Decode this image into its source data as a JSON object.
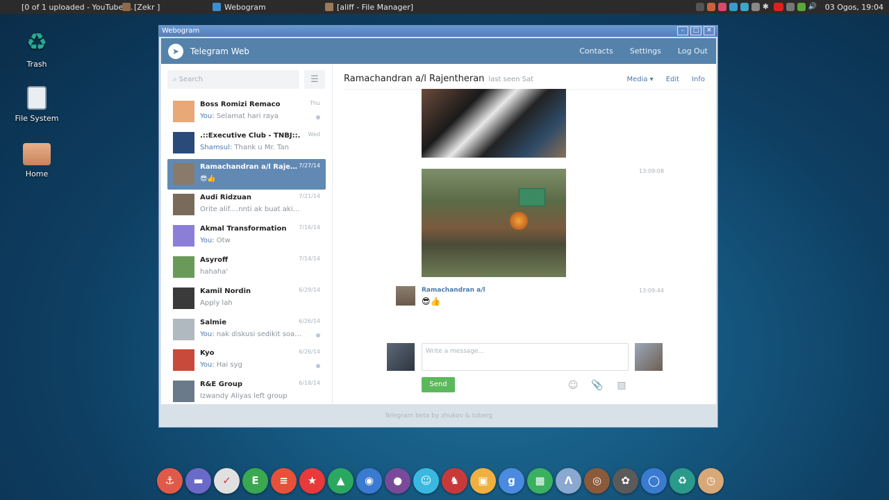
{
  "taskbar": {
    "tasks": [
      {
        "label": "[0 of 1 uploaded - YouTube ...",
        "color": "#7a5a4a"
      },
      {
        "label": "[Zekr  ]",
        "color": "#8a6a4a"
      },
      {
        "label": "Webogram",
        "color": "#3a8ed0"
      },
      {
        "label": "[aliff - File Manager]",
        "color": "#9a7a5a"
      }
    ],
    "clock": "03 Ogos, 19:04"
  },
  "desktop": {
    "icons": [
      {
        "label": "Trash"
      },
      {
        "label": "File System"
      },
      {
        "label": "Home"
      }
    ]
  },
  "window": {
    "title": "Webogram",
    "app_name": "Telegram Web",
    "nav": [
      "Contacts",
      "Settings",
      "Log Out"
    ],
    "footer": "Telegram beta by zhukov & toberg"
  },
  "sidebar": {
    "search_placeholder": "Search",
    "menu_icon": "☰",
    "chats": [
      {
        "name": "Boss Romizi Remaco",
        "date": "Thu",
        "you": "You:",
        "msg": " Selamat hari raya",
        "dot": true,
        "color": "#e8a878"
      },
      {
        "name": ".::Executive Club - TNBJ::.",
        "date": "Wed",
        "you": "Shamsul:",
        "msg": " Thank u Mr. Tan",
        "dot": false,
        "color": "#2a4a7a"
      },
      {
        "name": "Ramachandran a/l Rajentheran",
        "date": "7/27/14",
        "you": "",
        "msg": "😎👍",
        "dot": false,
        "color": "#8a7a6a"
      },
      {
        "name": "Audi Ridzuan",
        "date": "7/21/14",
        "you": "",
        "msg": "Orite alif....nnti ak buat akikah",
        "dot": false,
        "color": "#7a6a5a"
      },
      {
        "name": "Akmal Transformation",
        "date": "7/16/14",
        "you": "You:",
        "msg": " Otw",
        "dot": false,
        "color": "#8a7ed8"
      },
      {
        "name": "Asyroff",
        "date": "7/14/14",
        "you": "",
        "msg": "hahaha'",
        "dot": false,
        "color": "#6a9a5a"
      },
      {
        "name": "Kamil Nordin",
        "date": "6/29/14",
        "you": "",
        "msg": "Apply lah",
        "dot": false,
        "color": "#3a3a3a"
      },
      {
        "name": "Salmie",
        "date": "6/26/14",
        "you": "You:",
        "msg": " nak diskusi sedikit soal dokumen",
        "dot": true,
        "color": "#b0b8c0"
      },
      {
        "name": "Kyo",
        "date": "6/26/14",
        "you": "You:",
        "msg": " Hai syg",
        "dot": true,
        "color": "#c84a3a"
      },
      {
        "name": "R&E Group",
        "date": "6/18/14",
        "you": "",
        "msg": "Izwandy Aliyas left group",
        "dot": false,
        "color": "#6a7a8a"
      }
    ]
  },
  "conversation": {
    "peer_name": "Ramachandran a/l Rajentheran",
    "last_seen": "last seen Sat",
    "media_label": "Media ▾",
    "edit_label": "Edit",
    "info_label": "Info",
    "time1": "13:09:08",
    "sender": "Ramachandran a/l",
    "time2": "13:09:44",
    "message": "😎👍",
    "compose_placeholder": "Write a message...",
    "send_label": "Send",
    "icons": [
      "☺",
      "📎",
      "▨"
    ]
  },
  "dock": {
    "apps": [
      {
        "icon": "⚓",
        "color": "#e05a4a"
      },
      {
        "icon": "▬",
        "color": "#6a6ac8"
      },
      {
        "icon": "✓",
        "color": "#e0e0e0"
      },
      {
        "icon": "E",
        "color": "#3aa850"
      },
      {
        "icon": "≡",
        "color": "#e8503a"
      },
      {
        "icon": "★",
        "color": "#e83a3a"
      },
      {
        "icon": "▲",
        "color": "#2aa860"
      },
      {
        "icon": "◉",
        "color": "#3a7ad0"
      },
      {
        "icon": "●",
        "color": "#7a4a9a"
      },
      {
        "icon": "☺",
        "color": "#3ab8e0"
      },
      {
        "icon": "♞",
        "color": "#c83a3a"
      },
      {
        "icon": "▣",
        "color": "#f0b040"
      },
      {
        "icon": "g",
        "color": "#4a8ae0"
      },
      {
        "icon": "▦",
        "color": "#3ab060"
      },
      {
        "icon": "Λ",
        "color": "#8aa8d0"
      },
      {
        "icon": "◎",
        "color": "#8a5a3a"
      },
      {
        "icon": "✿",
        "color": "#5a5a5a"
      },
      {
        "icon": "◯",
        "color": "#3a7ad0"
      },
      {
        "icon": "♻",
        "color": "#2a9a8a"
      },
      {
        "icon": "◷",
        "color": "#d8a878"
      }
    ]
  }
}
